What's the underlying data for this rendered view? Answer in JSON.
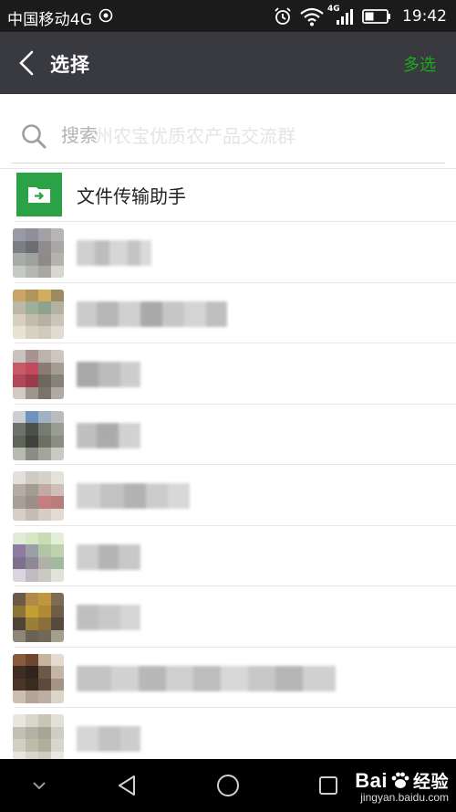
{
  "status_bar": {
    "carrier": "中国移动4G",
    "network_badge": "4G",
    "time": "19:42",
    "icons": [
      "signal-target-icon",
      "alarm-icon",
      "wifi-icon",
      "cell-signal-icon",
      "battery-icon"
    ]
  },
  "header": {
    "title": "选择",
    "multi_select": "多选"
  },
  "search": {
    "placeholder": "搜索",
    "background_hint": "州农宝优质农产品交流群"
  },
  "file_transfer": {
    "label": "文件传输助手"
  },
  "nav": {
    "icons": [
      "chevron-down-icon",
      "back-triangle-icon",
      "home-circle-icon",
      "recent-square-icon"
    ]
  },
  "watermark": {
    "brand": "Bai",
    "brand_suffix": "经验",
    "url": "jingyan.baidu.com"
  },
  "colors": {
    "accent_green": "#1aad19",
    "topbar": "#393a3f",
    "file_icon_green": "#2ba245"
  }
}
